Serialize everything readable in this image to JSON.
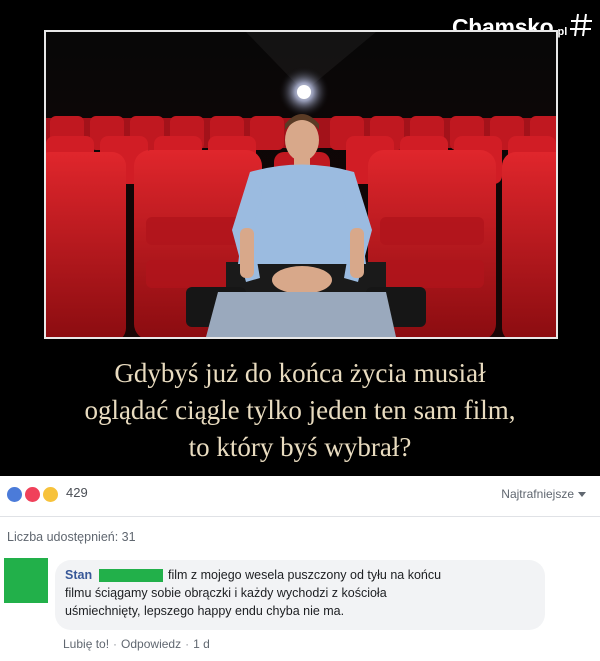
{
  "brand": {
    "name": "Chamsko",
    "tld": ".pl"
  },
  "meme": {
    "caption_lines": [
      "Gdybyś już do końca życia musiał",
      "oglądać ciągle tylko jeden ten sam film,",
      "to który byś wybrał?"
    ]
  },
  "post": {
    "reaction_count": "429",
    "reaction_icons": [
      "like-icon",
      "love-icon",
      "haha-icon"
    ],
    "sort_label": "Najtrafniejsze",
    "shares_label": "Liczba udostępnień: 31"
  },
  "comment": {
    "author": "Stan",
    "lines": [
      "film z mojego wesela puszczony od tyłu  na końcu",
      "filmu ściągamy sobie obrączki i każdy wychodzi z kościoła",
      "uśmiechnięty, lepszego happy endu chyba nie ma."
    ],
    "like_action": "Lubię to!",
    "reply_action": "Odpowiedz",
    "separator": "·",
    "time": "1 d"
  },
  "colors": {
    "caption": "#e9dcc0",
    "seat_red": "#c8141b",
    "redaction_green": "#22b04a",
    "link_blue": "#385898"
  }
}
